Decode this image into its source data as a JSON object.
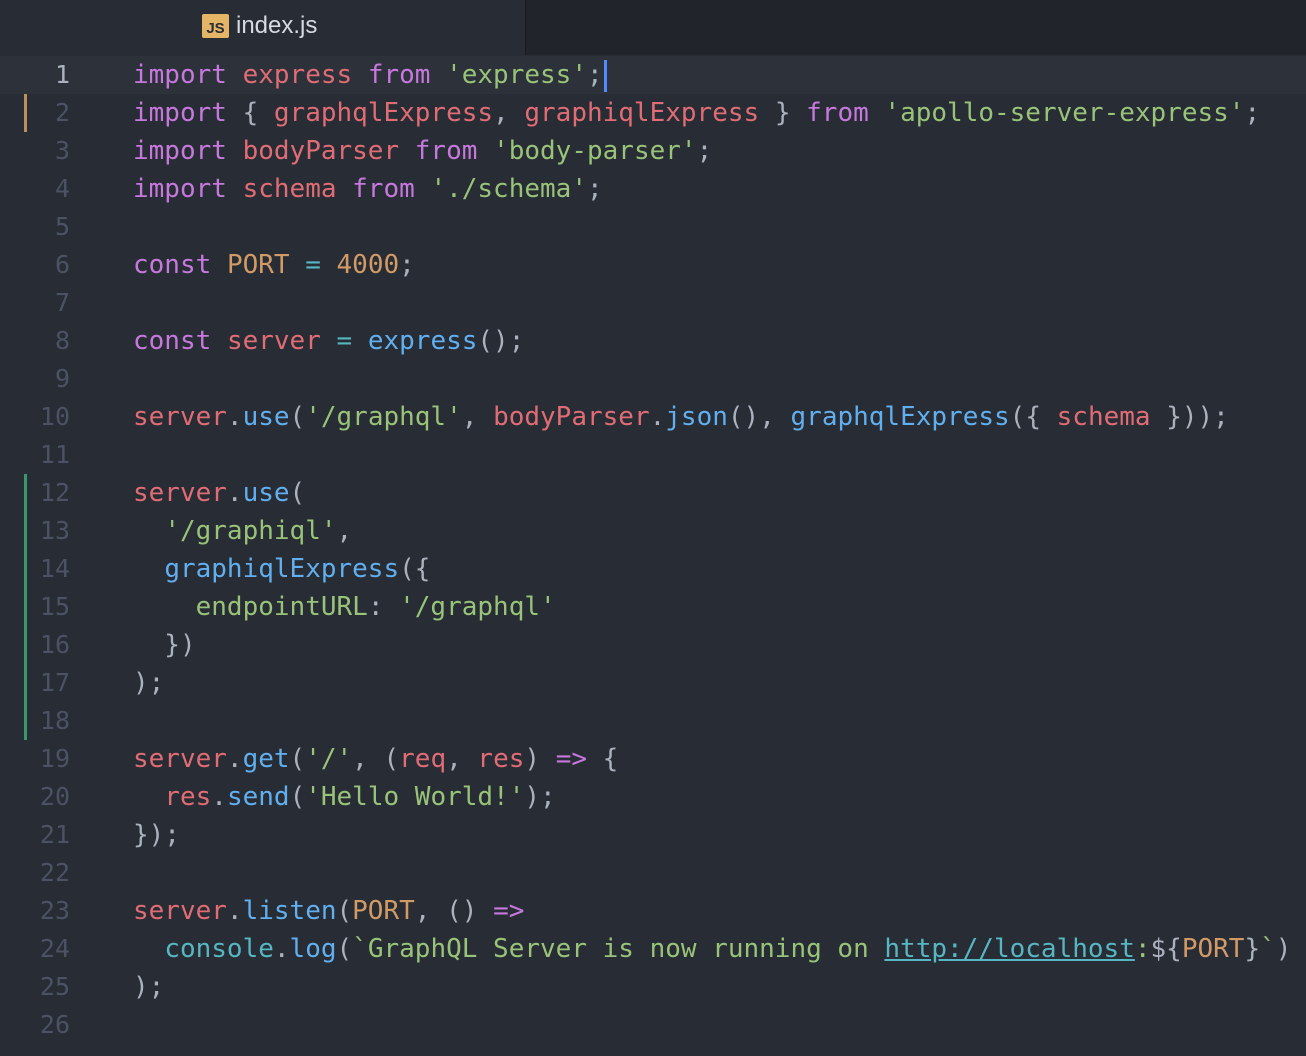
{
  "tab": {
    "icon_label": "JS",
    "title": "index.js"
  },
  "colors": {
    "keyword": "#c678dd",
    "variable": "#e06c75",
    "string": "#98c379",
    "function": "#61afef",
    "number": "#d19a66",
    "operator": "#56b6c2",
    "punctuation": "#abb2bf",
    "link": "#56b6c2"
  },
  "editor": {
    "cursor_line": 1,
    "lines": [
      {
        "n": "1",
        "git": null,
        "tokens": [
          [
            "import",
            "keyword"
          ],
          [
            " ",
            "punctuation"
          ],
          [
            "express",
            "variable"
          ],
          [
            " ",
            "punctuation"
          ],
          [
            "from",
            "keyword"
          ],
          [
            " ",
            "punctuation"
          ],
          [
            "'express'",
            "string"
          ],
          [
            ";",
            "punctuation"
          ]
        ]
      },
      {
        "n": "2",
        "git": "modified",
        "tokens": [
          [
            "import",
            "keyword"
          ],
          [
            " { ",
            "punctuation"
          ],
          [
            "graphqlExpress",
            "variable"
          ],
          [
            ", ",
            "punctuation"
          ],
          [
            "graphiqlExpress",
            "variable"
          ],
          [
            " } ",
            "punctuation"
          ],
          [
            "from",
            "keyword"
          ],
          [
            " ",
            "punctuation"
          ],
          [
            "'apollo-server-express'",
            "string"
          ],
          [
            ";",
            "punctuation"
          ]
        ]
      },
      {
        "n": "3",
        "git": null,
        "tokens": [
          [
            "import",
            "keyword"
          ],
          [
            " ",
            "punctuation"
          ],
          [
            "bodyParser",
            "variable"
          ],
          [
            " ",
            "punctuation"
          ],
          [
            "from",
            "keyword"
          ],
          [
            " ",
            "punctuation"
          ],
          [
            "'body-parser'",
            "string"
          ],
          [
            ";",
            "punctuation"
          ]
        ]
      },
      {
        "n": "4",
        "git": null,
        "tokens": [
          [
            "import",
            "keyword"
          ],
          [
            " ",
            "punctuation"
          ],
          [
            "schema",
            "variable"
          ],
          [
            " ",
            "punctuation"
          ],
          [
            "from",
            "keyword"
          ],
          [
            " ",
            "punctuation"
          ],
          [
            "'./schema'",
            "string"
          ],
          [
            ";",
            "punctuation"
          ]
        ]
      },
      {
        "n": "5",
        "git": null,
        "tokens": []
      },
      {
        "n": "6",
        "git": null,
        "tokens": [
          [
            "const",
            "keyword"
          ],
          [
            " ",
            "punctuation"
          ],
          [
            "PORT",
            "number"
          ],
          [
            " ",
            "punctuation"
          ],
          [
            "=",
            "operator"
          ],
          [
            " ",
            "punctuation"
          ],
          [
            "4000",
            "number"
          ],
          [
            ";",
            "punctuation"
          ]
        ]
      },
      {
        "n": "7",
        "git": null,
        "tokens": []
      },
      {
        "n": "8",
        "git": null,
        "tokens": [
          [
            "const",
            "keyword"
          ],
          [
            " ",
            "punctuation"
          ],
          [
            "server",
            "variable"
          ],
          [
            " ",
            "punctuation"
          ],
          [
            "=",
            "operator"
          ],
          [
            " ",
            "punctuation"
          ],
          [
            "express",
            "function"
          ],
          [
            "();",
            "punctuation"
          ]
        ]
      },
      {
        "n": "9",
        "git": null,
        "tokens": []
      },
      {
        "n": "10",
        "git": null,
        "tokens": [
          [
            "server",
            "variable"
          ],
          [
            ".",
            "punctuation"
          ],
          [
            "use",
            "function"
          ],
          [
            "(",
            "punctuation"
          ],
          [
            "'/graphql'",
            "string"
          ],
          [
            ", ",
            "punctuation"
          ],
          [
            "bodyParser",
            "variable"
          ],
          [
            ".",
            "punctuation"
          ],
          [
            "json",
            "function"
          ],
          [
            "(), ",
            "punctuation"
          ],
          [
            "graphqlExpress",
            "function"
          ],
          [
            "({ ",
            "punctuation"
          ],
          [
            "schema",
            "variable"
          ],
          [
            " }));",
            "punctuation"
          ]
        ]
      },
      {
        "n": "11",
        "git": null,
        "tokens": []
      },
      {
        "n": "12",
        "git": "added",
        "tokens": [
          [
            "server",
            "variable"
          ],
          [
            ".",
            "punctuation"
          ],
          [
            "use",
            "function"
          ],
          [
            "(",
            "punctuation"
          ]
        ]
      },
      {
        "n": "13",
        "git": "added",
        "tokens": [
          [
            "  ",
            "punctuation"
          ],
          [
            "'/graphiql'",
            "string"
          ],
          [
            ",",
            "punctuation"
          ]
        ]
      },
      {
        "n": "14",
        "git": "added",
        "tokens": [
          [
            "  ",
            "punctuation"
          ],
          [
            "graphiqlExpress",
            "function"
          ],
          [
            "({",
            "punctuation"
          ]
        ]
      },
      {
        "n": "15",
        "git": "added",
        "tokens": [
          [
            "    ",
            "punctuation"
          ],
          [
            "endpointURL",
            "string"
          ],
          [
            ": ",
            "punctuation"
          ],
          [
            "'/graphql'",
            "string"
          ]
        ]
      },
      {
        "n": "16",
        "git": "added",
        "tokens": [
          [
            "  })",
            "punctuation"
          ]
        ]
      },
      {
        "n": "17",
        "git": "added",
        "tokens": [
          [
            ");",
            "punctuation"
          ]
        ]
      },
      {
        "n": "18",
        "git": "added",
        "tokens": []
      },
      {
        "n": "19",
        "git": null,
        "tokens": [
          [
            "server",
            "variable"
          ],
          [
            ".",
            "punctuation"
          ],
          [
            "get",
            "function"
          ],
          [
            "(",
            "punctuation"
          ],
          [
            "'/'",
            "string"
          ],
          [
            ", (",
            "punctuation"
          ],
          [
            "req",
            "variable"
          ],
          [
            ", ",
            "punctuation"
          ],
          [
            "res",
            "variable"
          ],
          [
            ") ",
            "punctuation"
          ],
          [
            "=>",
            "keyword"
          ],
          [
            " {",
            "punctuation"
          ]
        ]
      },
      {
        "n": "20",
        "git": null,
        "tokens": [
          [
            "  ",
            "punctuation"
          ],
          [
            "res",
            "variable"
          ],
          [
            ".",
            "punctuation"
          ],
          [
            "send",
            "function"
          ],
          [
            "(",
            "punctuation"
          ],
          [
            "'Hello World!'",
            "string"
          ],
          [
            ");",
            "punctuation"
          ]
        ]
      },
      {
        "n": "21",
        "git": null,
        "tokens": [
          [
            "});",
            "punctuation"
          ]
        ]
      },
      {
        "n": "22",
        "git": null,
        "tokens": []
      },
      {
        "n": "23",
        "git": null,
        "tokens": [
          [
            "server",
            "variable"
          ],
          [
            ".",
            "punctuation"
          ],
          [
            "listen",
            "function"
          ],
          [
            "(",
            "punctuation"
          ],
          [
            "PORT",
            "number"
          ],
          [
            ", () ",
            "punctuation"
          ],
          [
            "=>",
            "keyword"
          ]
        ]
      },
      {
        "n": "24",
        "git": null,
        "tokens": [
          [
            "  ",
            "punctuation"
          ],
          [
            "console",
            "operator"
          ],
          [
            ".",
            "punctuation"
          ],
          [
            "log",
            "function"
          ],
          [
            "(",
            "punctuation"
          ],
          [
            "`GraphQL Server is now running on ",
            "string"
          ],
          [
            "http://localhost",
            "link"
          ],
          [
            ":",
            "string"
          ],
          [
            "${",
            "punctuation"
          ],
          [
            "PORT",
            "number"
          ],
          [
            "}",
            "punctuation"
          ],
          [
            "`",
            "string"
          ],
          [
            ")",
            "punctuation"
          ]
        ]
      },
      {
        "n": "25",
        "git": null,
        "tokens": [
          [
            ");",
            "punctuation"
          ]
        ]
      },
      {
        "n": "26",
        "git": null,
        "tokens": []
      }
    ]
  }
}
